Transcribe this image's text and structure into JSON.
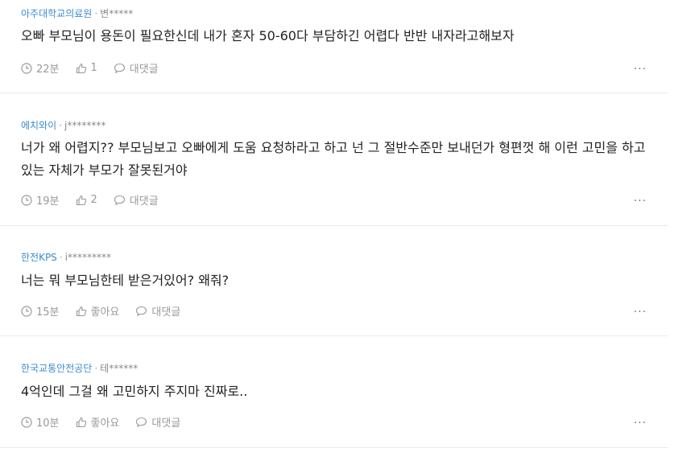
{
  "comments": [
    {
      "company": "아주대학교의료원",
      "author": "변*****",
      "text": "오빠 부모님이 용돈이 필요한신데 내가 혼자 50-60다 부담하긴 어렵다 반반 내자라고해보자",
      "time": "22분",
      "likes": "1",
      "reply_label": "대댓글",
      "more": "···"
    },
    {
      "company": "에치와이",
      "author": "j********",
      "text": "너가 왜 어렵지?? 부모님보고 오빠에게 도움 요청하라고 하고 넌 그 절반수준만 보내던가 형편껏 해 이런 고민을 하고 있는 자체가 부모가 잘못된거야",
      "time": "19분",
      "likes": "2",
      "reply_label": "대댓글",
      "more": "···"
    },
    {
      "company": "한전KPS",
      "author": "i*********",
      "text": "너는 뭐 부모님한테 받은거있어? 왜줘?",
      "time": "15분",
      "likes": "좋아요",
      "reply_label": "대댓글",
      "more": "···"
    },
    {
      "company": "한국교통안전공단",
      "author": "테******",
      "text": "4억인데 그걸 왜 고민하지 주지마 진짜로..",
      "time": "10분",
      "likes": "좋아요",
      "reply_label": "대댓글",
      "more": "···"
    }
  ]
}
